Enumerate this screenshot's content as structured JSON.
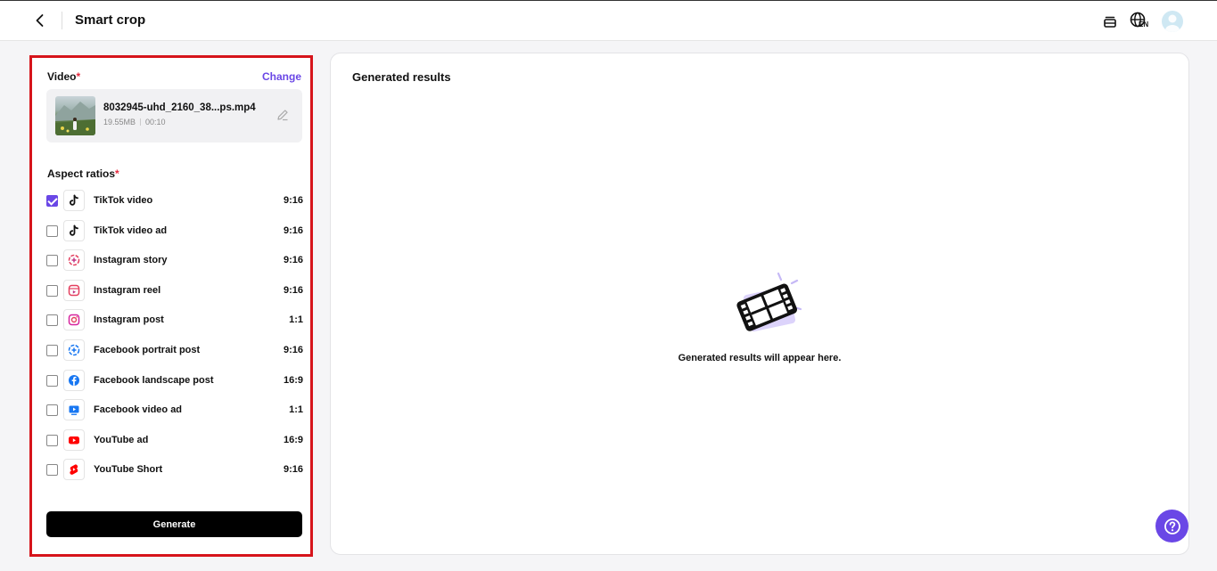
{
  "header": {
    "title": "Smart crop",
    "back_icon": "chevron-left-icon",
    "queue_icon": "stack-icon",
    "language_icon": "globe-icon",
    "language_code": "EN",
    "avatar_icon": "user-avatar-icon"
  },
  "video_section": {
    "label": "Video",
    "required_mark": "*",
    "change_label": "Change",
    "file_name": "8032945-uhd_2160_38...ps.mp4",
    "file_size": "19.55MB",
    "duration": "00:10"
  },
  "aspect_section": {
    "label": "Aspect ratios",
    "required_mark": "*",
    "items": [
      {
        "name": "TikTok video",
        "ratio": "9:16",
        "checked": true,
        "icon": "tiktok-icon"
      },
      {
        "name": "TikTok video ad",
        "ratio": "9:16",
        "checked": false,
        "icon": "tiktok-icon"
      },
      {
        "name": "Instagram story",
        "ratio": "9:16",
        "checked": false,
        "icon": "instagram-story-icon"
      },
      {
        "name": "Instagram reel",
        "ratio": "9:16",
        "checked": false,
        "icon": "instagram-reel-icon"
      },
      {
        "name": "Instagram post",
        "ratio": "1:1",
        "checked": false,
        "icon": "instagram-icon"
      },
      {
        "name": "Facebook portrait post",
        "ratio": "9:16",
        "checked": false,
        "icon": "facebook-story-icon"
      },
      {
        "name": "Facebook landscape post",
        "ratio": "16:9",
        "checked": false,
        "icon": "facebook-icon"
      },
      {
        "name": "Facebook video ad",
        "ratio": "1:1",
        "checked": false,
        "icon": "facebook-video-icon"
      },
      {
        "name": "YouTube ad",
        "ratio": "16:9",
        "checked": false,
        "icon": "youtube-icon"
      },
      {
        "name": "YouTube Short",
        "ratio": "9:16",
        "checked": false,
        "icon": "youtube-shorts-icon"
      }
    ]
  },
  "generate_label": "Generate",
  "results": {
    "title": "Generated results",
    "empty_text": "Generated results will appear here.",
    "empty_icon": "film-strip-icon"
  },
  "help_icon": "question-mark-icon",
  "colors": {
    "accent": "#6a47e6",
    "highlight_border": "#d6141b",
    "required": "#e5293e",
    "button": "#000000"
  }
}
